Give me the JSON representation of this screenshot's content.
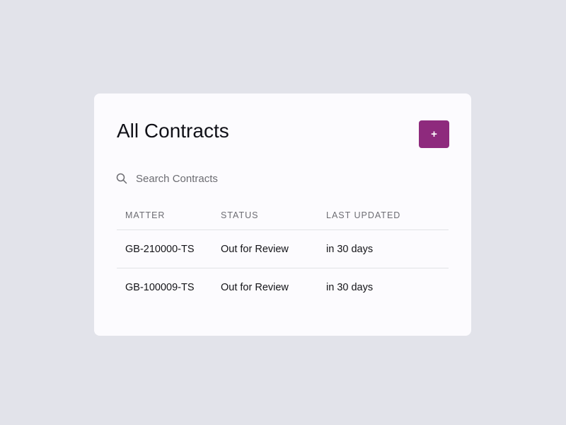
{
  "page": {
    "title": "All Contracts",
    "add_button_label": "+",
    "accent_color": "#8e2a7d"
  },
  "search": {
    "icon": "search-icon",
    "placeholder": "Search Contracts",
    "value": ""
  },
  "table": {
    "columns": [
      "MATTER",
      "STATUS",
      "LAST UPDATED"
    ],
    "rows": [
      {
        "matter": "GB-210000-TS",
        "status": "Out for Review",
        "last_updated": "in 30 days"
      },
      {
        "matter": "GB-100009-TS",
        "status": "Out for Review",
        "last_updated": "in 30 days"
      }
    ]
  }
}
